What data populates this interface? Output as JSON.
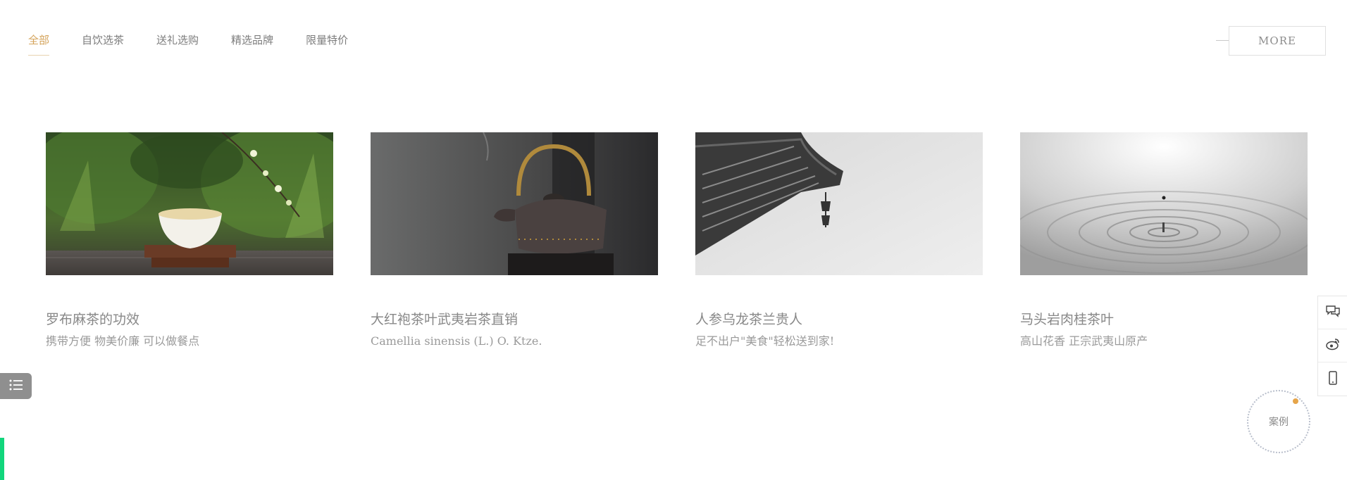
{
  "tabs": [
    {
      "label": "全部",
      "active": true
    },
    {
      "label": "自饮选茶",
      "active": false
    },
    {
      "label": "送礼选购",
      "active": false
    },
    {
      "label": "精选品牌",
      "active": false
    },
    {
      "label": "限量特价",
      "active": false
    }
  ],
  "more_label": "MORE",
  "cards": [
    {
      "title": "罗布麻茶的功效",
      "desc": "携带方便 物美价廉 可以做餐点",
      "image": "tea-cup-garden"
    },
    {
      "title": "大红袍茶叶武夷岩茶直销",
      "desc": "Camellia sinensis (L.) O. Ktze.",
      "image": "iron-teapot"
    },
    {
      "title": "人参乌龙茶兰贵人",
      "desc": "足不出户\"美食\"轻松送到家!",
      "image": "temple-eaves-bells"
    },
    {
      "title": "马头岩肉桂茶叶",
      "desc": "高山花香 正宗武夷山原产",
      "image": "water-ripple"
    }
  ],
  "side_tools": [
    {
      "icon": "chat-icon"
    },
    {
      "icon": "weibo-icon"
    },
    {
      "icon": "mobile-icon"
    }
  ],
  "case_label": "案例",
  "colors": {
    "accent": "#d4a35a",
    "text": "#888888",
    "green_bar": "#12d67c",
    "case_dot": "#e6a54a"
  }
}
